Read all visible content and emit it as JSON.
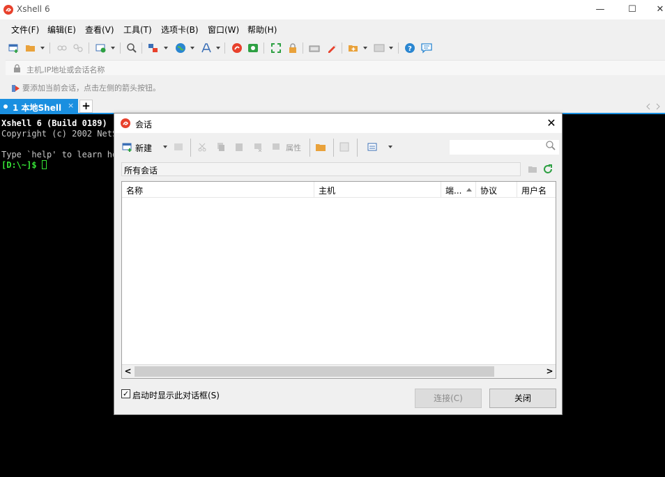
{
  "window": {
    "title": "Xshell 6",
    "minimize": "—",
    "maximize": "☐",
    "close": "✕"
  },
  "menu": [
    "文件(F)",
    "编辑(E)",
    "查看(V)",
    "工具(T)",
    "选项卡(B)",
    "窗口(W)",
    "帮助(H)"
  ],
  "address_bar": {
    "placeholder": "主机,IP地址或会话名称"
  },
  "hint_bar": {
    "text": "要添加当前会话，点击左侧的箭头按钮。"
  },
  "tabs": [
    {
      "label": "1 本地Shell",
      "close": "×"
    }
  ],
  "tab_add": "+",
  "terminal": {
    "lines": [
      "Xshell 6 (Build 0189)",
      "Copyright (c) 2002 NetSarang Computer, Inc. All rights reserved.",
      "Type `help' to learn how to use Xshell prompt."
    ],
    "prompt": "[D:\\~]$ "
  },
  "dialog": {
    "title": "会话",
    "close": "✕",
    "toolbar": {
      "new_label": "新建",
      "properties_label": "属性"
    },
    "search": {
      "value": ""
    },
    "folder_path": "所有会话",
    "columns": [
      "名称",
      "主机",
      "端...",
      "协议",
      "用户名"
    ],
    "startup_checkbox": {
      "checked": true,
      "mark": "✓",
      "label": "启动时显示此对话框(S)"
    },
    "buttons": {
      "connect": "连接(C)",
      "close": "关闭"
    },
    "scroll": {
      "left": "<",
      "right": ">"
    }
  },
  "colors": {
    "tab_accent": "#1a8fe0",
    "prompt_green": "#36e436",
    "brand_red": "#e8412c"
  }
}
